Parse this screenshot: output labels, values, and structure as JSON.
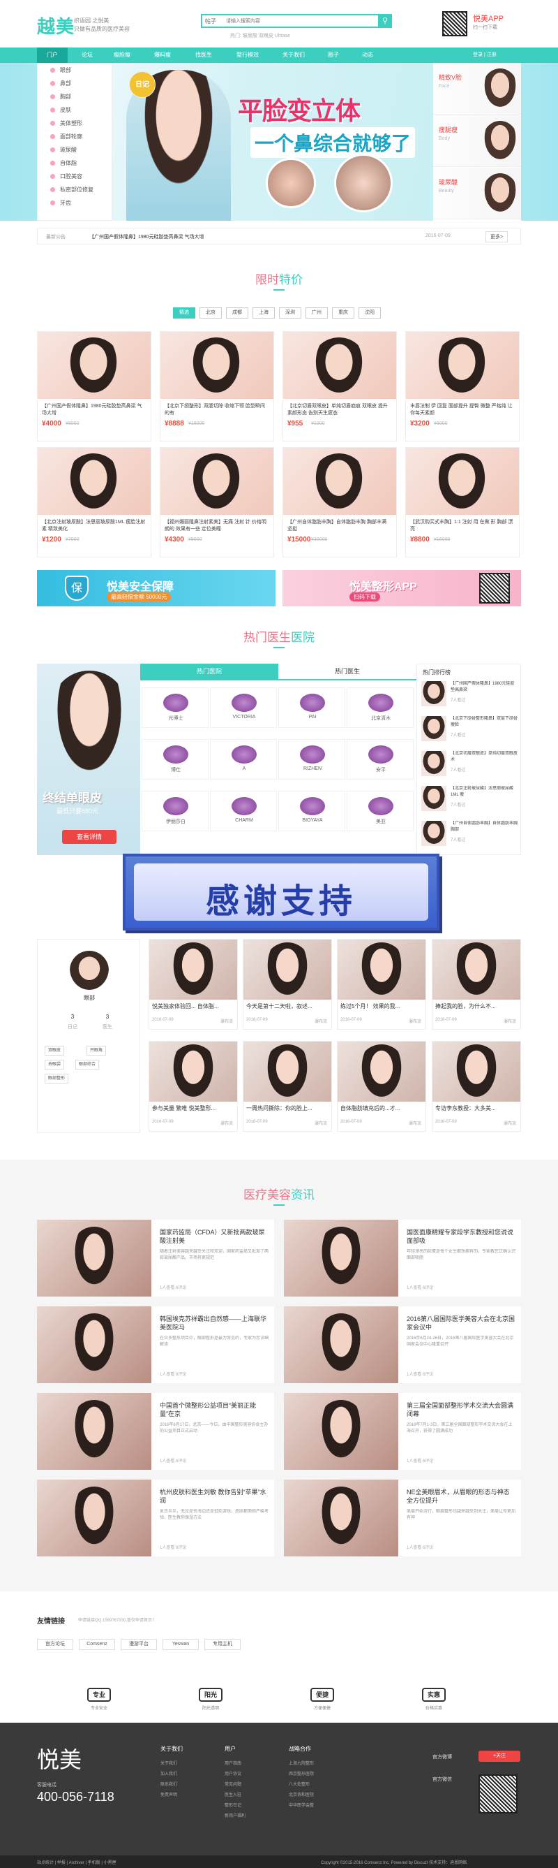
{
  "header": {
    "logo": "越美",
    "slogan1": "织语园 之悦美",
    "slogan2": "只做有品质的医疗美容",
    "search_select": "帖子",
    "search_placeholder": "请输入搜索内容",
    "hot": "热门: 玻尿酸 双眼皮 Ultrase",
    "app_title": "悦美APP",
    "app_sub": "扫一扫下载"
  },
  "nav": {
    "items": [
      "门户",
      "论坛",
      "瘦脸瘦",
      "爆料瘦",
      "找医生",
      "整行模效",
      "关于我们",
      "圈子",
      "动态"
    ],
    "right": "登录 | 注册"
  },
  "sidemenu": [
    "眼部",
    "鼻部",
    "胸部",
    "皮肤",
    "美体塑形",
    "面部轮廓",
    "玻尿酸",
    "自体脂",
    "口腔美容",
    "私密部位修复",
    "牙齿"
  ],
  "hero": {
    "badge": "日记",
    "line1": "平脸变立体",
    "line2": "一个鼻综合就够了"
  },
  "side_cards": [
    {
      "label": "精致V脸",
      "sub": "Face"
    },
    {
      "label": "瘦腿瘦",
      "sub": "Body"
    },
    {
      "label": "玻尿酸",
      "sub": "Beauty"
    }
  ],
  "notice": {
    "label": "最新公告",
    "text": "【广州国产假体隆鼻】1980元硅胶垫高鼻梁 气场大增",
    "date": "2016-07-09",
    "more": "更多>"
  },
  "section1": {
    "a": "限时",
    "b": "特价"
  },
  "cities": [
    "精选",
    "北京",
    "成都",
    "上海",
    "深圳",
    "广州",
    "重庆",
    "沈阳"
  ],
  "products": [
    {
      "title": "【广州国产假体隆鼻】1980元硅胶垫高鼻梁 气场大增",
      "price": "¥4000",
      "old": "¥8000"
    },
    {
      "title": "【北京下颌整形】双腮切除 收缩下颚 脸型瞬间的有",
      "price": "¥8888",
      "old": "¥18000"
    },
    {
      "title": "【北京切眉双眼皮】单纯切眉疤痕 双眼皮 提升素颜形态 告别天生疲态",
      "price": "¥955",
      "old": "¥1000"
    },
    {
      "title": "丰唇法制 伊 回复 面部提升 提臀 微整 严格纯 让你每天素颜",
      "price": "¥3200",
      "old": "¥6000"
    },
    {
      "title": "【北京注射玻尿酸】法思丽玻尿酸1ML 瘦脸注射素 精致美化",
      "price": "¥1200",
      "old": "¥7000"
    },
    {
      "title": "【福州媚丽隆鼻注射素美】无痛 注射 针 价格明朗的 效果有一些 定位美瞳",
      "price": "¥4300",
      "old": "¥9000"
    },
    {
      "title": "【广州自体脂肪丰胸】自体脂肪丰胸 胸部丰满 坚挺",
      "price": "¥15000",
      "old": "¥30000"
    },
    {
      "title": "【武汉购买式丰胸】1:1 注射 用 在做 形 胸部 漂亮",
      "price": "¥8800",
      "old": "¥16000"
    }
  ],
  "ads": {
    "left_icon": "保",
    "left_title": "悦美安全保障",
    "left_sub": "最高赔偿金额 50000元",
    "right_title": "悦美整形APP",
    "right_sub": "扫码下载"
  },
  "section2": {
    "a": "热门医生",
    "b": "医院"
  },
  "hospital_banner": {
    "title": "终结单眼皮",
    "sub": "最低只要680元",
    "btn": "查看详情"
  },
  "tabs2": [
    "热门医院",
    "热门医生"
  ],
  "hospital_logos": [
    {
      "name": "光博士",
      "sub": "Dr.laser"
    },
    {
      "name": "VICTORIA",
      "sub": "维多利亚医疗美容"
    },
    {
      "name": "PAI",
      "sub": "广州荔湾医院"
    },
    {
      "name": "北京清木",
      "sub": "北京清木医疗美容"
    },
    {
      "name": "博仕",
      "sub": "博仕整形"
    },
    {
      "name": "A",
      "sub": "石家庄美容医院"
    },
    {
      "name": "RIZHEN",
      "sub": "丽珍医疗美容"
    },
    {
      "name": "安平",
      "sub": "安平整形美容"
    },
    {
      "name": "伊丽莎白",
      "sub": "汤丽莎白医疗美容"
    },
    {
      "name": "CHARM",
      "sub": "上海伟美整形"
    },
    {
      "name": "BIOYAYA",
      "sub": "百悦雅医疗美容"
    },
    {
      "name": "美亚",
      "sub": "美亚整形"
    }
  ],
  "rank": {
    "head": "热门排行榜",
    "items": [
      {
        "t": "【广州国产假体隆鼻】1980元硅胶垫高鼻梁",
        "c": "7人看过"
      },
      {
        "t": "【北京下颌骨整形隆鼻】双层下颌骨 瘦脸",
        "c": "7人看过"
      },
      {
        "t": "【北京切眉双眼皮】单纯切眉双眼皮术",
        "c": "7人看过"
      },
      {
        "t": "【北京注射玻尿酸】法思丽玻尿酸1ML 瘦",
        "c": "7人看过"
      },
      {
        "t": "【广州自体脂肪丰胸】自体脂肪丰胸 胸部",
        "c": "7人看过"
      }
    ]
  },
  "thanks": "感谢支持",
  "doctor": {
    "name": "眼部",
    "s1": "3",
    "s1l": "日记",
    "s2": "3",
    "s2l": "医生",
    "tags": [
      "双眼皮",
      "开眼角",
      "去眼袋",
      "祛眼袋",
      "眼部综合",
      "眼部整形",
      "眼综合整形"
    ]
  },
  "diaries": [
    {
      "t": "悦美独家体验回... 自体脂...",
      "d": "2016-07-09",
      "l": "瀑布流"
    },
    {
      "t": "今天是第十二天啦，叙述...",
      "d": "2016-07-09",
      "l": "瀑布流"
    },
    {
      "t": "练过5个月！ 效果的我...",
      "d": "2016-07-09",
      "l": "瀑布流"
    },
    {
      "t": "捧起我的脸，为什么不...",
      "d": "2016-07-09",
      "l": "瀑布流"
    },
    {
      "t": "参与美量 繁唯 悦美整形...",
      "d": "2016-07-09",
      "l": "瀑布流"
    },
    {
      "t": "一周热问撕除：你的脸上...",
      "d": "2016-07-09",
      "l": "瀑布流"
    },
    {
      "t": "自体脂肪填充后的...才...",
      "d": "2016-07-09",
      "l": "瀑布流"
    },
    {
      "t": "专访李东教授：大多美...",
      "d": "2016-07-09",
      "l": "瀑布流"
    }
  ],
  "section3": {
    "a": "医疗美容",
    "b": "资讯"
  },
  "news": [
    {
      "t": "国家药监局（CFDA）又新批两款玻尿酸注射美",
      "d": "随着注射美容越来越受关注和欢迎，国家药监局又批准了两款玻尿酸产品，市场将更规范",
      "m": "1人查看    6评论"
    },
    {
      "t": "国医面康精耀专家段学东教授和您说说面部吸",
      "d": "年轻漂亮的脸蛋是每个女生都想拥有的，专家教您正确认识面部吸脂",
      "m": "1人查看    6评论"
    },
    {
      "t": "韩国埃克苏祥霸出自然感——上海联华美医院马",
      "d": "在众多整形项目中，眼部整形是最为常见的，专家为您详细解读",
      "m": "1人查看    6评论"
    },
    {
      "t": "2016第八届国际医学美容大会在北京国家会议中",
      "d": "2016年6月24-26日，2016第八届国际医学美容大会在北京国家会议中心隆重召开",
      "m": "1人查看    6评论"
    },
    {
      "t": "中国首个微整形公益项目“美丽正能量”在京",
      "d": "2016年6月17日，北京——今日，由中国整形美容协会主办的公益项目正式启动",
      "m": "1人查看    6评论"
    },
    {
      "t": "第三届全国面部整形学术交流大会圆满闭幕",
      "d": "2016年7月1-3日，第三届全国面部整形学术交流大会在上海召开，获得了圆满成功",
      "m": "1人查看    6评论"
    },
    {
      "t": "杭州皮肤科医生刘敏 教你告别“苹果”水润",
      "d": "夏日炎炎，无论是去海边还是逛街游玩，皮肤都面临严峻考验，医生教你保湿方法",
      "m": "1人查看    6评论"
    },
    {
      "t": "NE全美眼眉术，从眉眼的形态与神态全方位提升",
      "d": "美眉开始流行，眼眉整形也越来越受到关注，美眉让你更加有神",
      "m": "1人查看    6评论"
    }
  ],
  "links": {
    "head": "友情链接",
    "qq": "申请链接QQ:1589767930,暂仅申请首页！",
    "items": [
      "官方论坛",
      "Comsenz",
      "漫游平台",
      "Yeswan",
      "专用主机"
    ]
  },
  "guarantees": [
    {
      "i": "专业",
      "l": "专业安全"
    },
    {
      "i": "阳光",
      "l": "阳光透明"
    },
    {
      "i": "便捷",
      "l": "方便便捷"
    },
    {
      "i": "实惠",
      "l": "价格实惠"
    }
  ],
  "footer": {
    "logo": "悦美",
    "service": "客服电话",
    "phone": "400-056-7118",
    "cols": [
      {
        "h": "关于我们",
        "items": [
          "关于我们",
          "加入我们",
          "联系我们",
          "免责声明"
        ]
      },
      {
        "h": "用户",
        "items": [
          "用户指南",
          "用户协议",
          "常见问题",
          "医生入驻",
          "整形日记",
          "新用户福利"
        ]
      },
      {
        "h": "战略合作",
        "items": [
          "上海九院整形",
          "西京整形医院",
          "八大处整形",
          "北京协和医院",
          "中华医学会整"
        ]
      }
    ],
    "weibo": "官方微博",
    "weixin": "官方微信",
    "follow": "+关注",
    "bottom_left": "站点统计  |  举报  |  Archiver  |  手机版  |  小黑屋",
    "bottom_right": "Copyright  ©2015-2016  Comsenz Inc.  Powered by DiscuzI  技术支持：迪恩网络"
  }
}
